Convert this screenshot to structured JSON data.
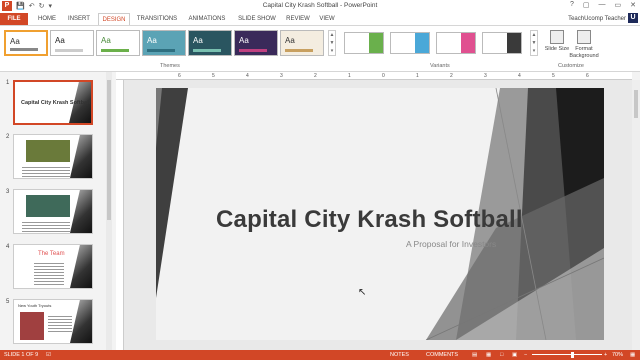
{
  "titlebar": {
    "title": "Capital City Krash Softball - PowerPoint",
    "qat": {
      "app_icon": "P",
      "save_icon": "save-icon",
      "undo_icon": "undo-icon",
      "redo_icon": "redo-icon"
    },
    "controls": [
      "?",
      "▢",
      "—",
      "▭",
      "✕"
    ]
  },
  "tabs": {
    "items": [
      "FILE",
      "HOME",
      "INSERT",
      "DESIGN",
      "TRANSITIONS",
      "ANIMATIONS",
      "SLIDE SHOW",
      "REVIEW",
      "VIEW"
    ],
    "active": "DESIGN",
    "user": "TeachUcomp Teacher",
    "avatar": "U"
  },
  "ribbon": {
    "themes_label": "Themes",
    "variants_label": "Variants",
    "customize_label": "Customize",
    "themes": [
      {
        "text": "Aa",
        "bg": "#ffffff",
        "fg": "#333333",
        "bar": "#888888"
      },
      {
        "text": "Aa",
        "bg": "#ffffff",
        "fg": "#222222",
        "bar": "#cccccc"
      },
      {
        "text": "Aa",
        "bg": "#ffffff",
        "fg": "#4a8a3a",
        "bar": "#6bb04a"
      },
      {
        "text": "Aa",
        "bg": "#5ba3b5",
        "fg": "#ffffff",
        "bar": "#2e6f80"
      },
      {
        "text": "Aa",
        "bg": "#2a5560",
        "fg": "#ffffff",
        "bar": "#79c0b0"
      },
      {
        "text": "Aa",
        "bg": "#3a2a5a",
        "fg": "#ffffff",
        "bar": "#c04080"
      },
      {
        "text": "Aa",
        "bg": "#f4ede0",
        "fg": "#333333",
        "bar": "#c8a060"
      }
    ],
    "variants": [
      {
        "stripe": "#6ab04c"
      },
      {
        "stripe": "#4aa8d8"
      },
      {
        "stripe": "#e05090"
      },
      {
        "stripe": "#3a3a3a"
      }
    ],
    "slide_size_label": "Slide Size",
    "format_bg_label": "Format Background"
  },
  "thumbnails": [
    {
      "num": "1",
      "title": "Capital City Krash Softball"
    },
    {
      "num": "2",
      "title": ""
    },
    {
      "num": "3",
      "title": ""
    },
    {
      "num": "4",
      "title": "The Team"
    },
    {
      "num": "5",
      "title": "New Youth Tryouts"
    }
  ],
  "ruler_ticks": [
    "6",
    "5",
    "4",
    "3",
    "2",
    "1",
    "0",
    "1",
    "2",
    "3",
    "4",
    "5",
    "6"
  ],
  "slide": {
    "title": "Capital City Krash Softball",
    "subtitle": "A Proposal for Investors"
  },
  "status": {
    "slide_info": "SLIDE 1 OF 9",
    "notes": "NOTES",
    "comments": "COMMENTS",
    "zoom": "70%",
    "zoom_fraction": 0.55
  }
}
